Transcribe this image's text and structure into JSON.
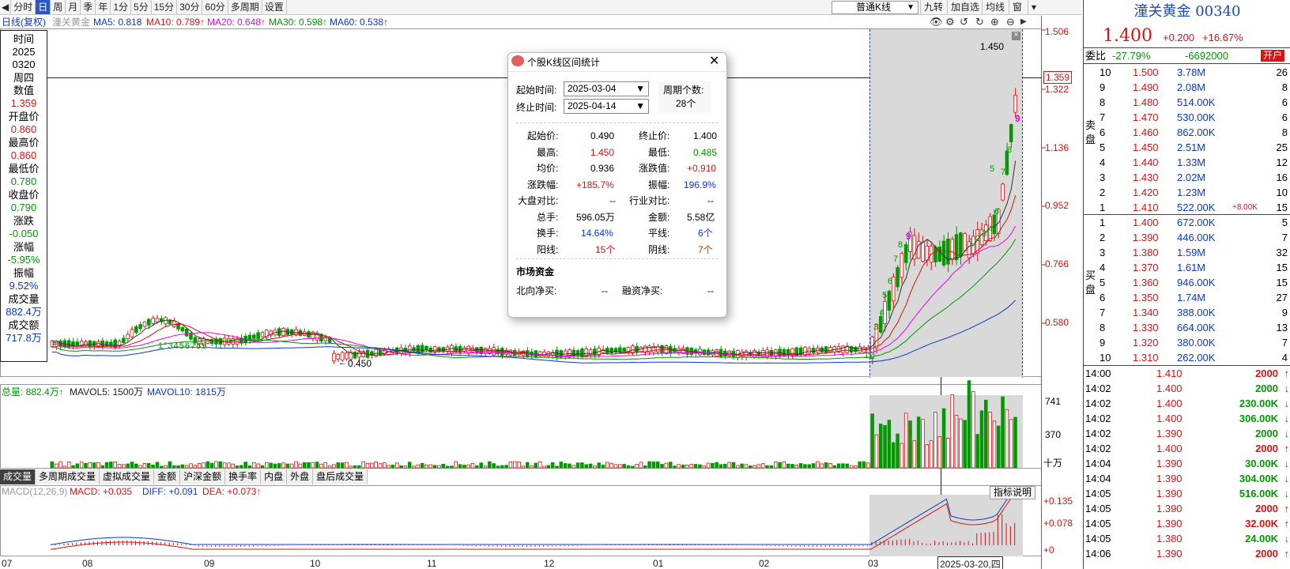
{
  "toolbar": {
    "periods": [
      "分时",
      "日",
      "周",
      "月",
      "季",
      "年",
      "1分",
      "5分",
      "15分",
      "30分",
      "60分",
      "多周期",
      "设置"
    ],
    "active_period": "日",
    "ktype": "普通K线",
    "nine": "九转",
    "add_watch": "加自选",
    "ma_line": "均线",
    "window": "窗"
  },
  "ma_info": {
    "label": "日线(复权)",
    "name": "潼关黄金",
    "ma5": "MA5: 0.818",
    "ma10": "MA10: 0.789↑",
    "ma20": "MA20: 0.648↑",
    "ma30": "MA30: 0.598↑",
    "ma60": "MA60: 0.538↑",
    "colors": {
      "ma5": "#0a38d0",
      "ma10": "#d11",
      "ma20": "#e0e",
      "ma30": "#090",
      "ma60": "#0a38d0"
    }
  },
  "left_panel": {
    "items": [
      {
        "label": "时间",
        "value": "2025",
        "value2": "0320"
      },
      {
        "label": "周四",
        "value": ""
      },
      {
        "label": "数值",
        "value": "1.359",
        "color": "red"
      },
      {
        "label": "开盘价",
        "value": "0.860",
        "color": "red"
      },
      {
        "label": "最高价",
        "value": "0.860",
        "color": "red"
      },
      {
        "label": "最低价",
        "value": "0.780",
        "color": "green"
      },
      {
        "label": "收盘价",
        "value": "0.790",
        "color": "green"
      },
      {
        "label": "涨跌",
        "value": "-0.050",
        "color": "green"
      },
      {
        "label": "涨幅",
        "value": "-5.95%",
        "color": "green"
      },
      {
        "label": "振幅",
        "value": "9.52%",
        "color": "blue"
      },
      {
        "label": "成交量",
        "value": "882.4万",
        "color": "blue"
      },
      {
        "label": "成交额",
        "value": "717.8万",
        "color": "blue"
      }
    ]
  },
  "price_axis": [
    "1.506",
    "1.359",
    "1.322",
    "1.136",
    "0.952",
    "0.766",
    "0.580"
  ],
  "chart_notes": {
    "high": "1.450",
    "low": "0.450"
  },
  "td_counts": {
    "a": "12",
    "b": "3",
    "c": "4",
    "d": "5",
    "e": "6",
    "f": "7",
    "g": "8",
    "h": "9",
    "i": "1",
    "j": "2",
    "k": "3",
    "l": "4",
    "m": "5",
    "n": "6",
    "o": "7",
    "p": "8",
    "q": "9",
    "early": "1°3456789"
  },
  "volume_info": {
    "total": "总量: 882.4万↑",
    "mavol5": "MAVOL5: 1500万",
    "mavol10": "MAVOL10: 1815万",
    "axis": [
      "741",
      "370",
      "十万"
    ]
  },
  "tabs": [
    "成交量",
    "多周期成交量",
    "虚拟成交量",
    "金额",
    "沪深金额",
    "换手率",
    "内盘",
    "外盘",
    "盘后成交量"
  ],
  "macd_info": {
    "label": "MACD(12,26,9)",
    "macd": "MACD: +0.035",
    "diff": "DIFF: +0.091",
    "dea": "DEA: +0.073↑",
    "axis": [
      "+0.135",
      "+0.078",
      "+0"
    ],
    "help": "指标说明"
  },
  "x_axis": [
    "07",
    "08",
    "09",
    "10",
    "11",
    "12",
    "01",
    "02",
    "03"
  ],
  "cursor_date": "2025-03-20,四",
  "dialog": {
    "title": "个股K线区间统计",
    "start_label": "起始时间:",
    "start": "2025-03-04",
    "end_label": "终止时间:",
    "end": "2025-04-14",
    "period_label": "周期个数:",
    "period_count": "28个",
    "rows": [
      [
        "起始价:",
        "0.490",
        "终止价:",
        "1.400"
      ],
      [
        "最高:",
        "1.450",
        "最低:",
        "0.485"
      ],
      [
        "均价:",
        "0.936",
        "涨跌值:",
        "+0.910"
      ],
      [
        "涨跌幅:",
        "+185.7%",
        "振幅:",
        "196.9%"
      ],
      [
        "大盘对比:",
        "--",
        "行业对比:",
        "--"
      ],
      [
        "总手:",
        "596.05万",
        "金额:",
        "5.58亿"
      ],
      [
        "换手:",
        "14.64%",
        "平线:",
        "6个"
      ],
      [
        "阳线:",
        "15个",
        "阴线:",
        "7个"
      ]
    ],
    "funds_title": "市场资金",
    "north_label": "北向净买:",
    "north": "--",
    "margin_label": "融资净买:",
    "margin": "--"
  },
  "quote": {
    "name": "潼关黄金 00340",
    "price": "1.400",
    "change": "+0.200",
    "pct": "+16.67%",
    "ratio_label": "委比",
    "ratio": "-27.79%",
    "diff": "-6692000",
    "open_btn": "开户",
    "sell_label": "卖盘",
    "buy_label": "买盘",
    "asks": [
      {
        "lvl": "10",
        "price": "1.500",
        "vol": "3.78M",
        "n": "26"
      },
      {
        "lvl": "9",
        "price": "1.490",
        "vol": "2.08M",
        "n": "8"
      },
      {
        "lvl": "8",
        "price": "1.480",
        "vol": "514.00K",
        "n": "6"
      },
      {
        "lvl": "7",
        "price": "1.470",
        "vol": "530.00K",
        "n": "6"
      },
      {
        "lvl": "6",
        "price": "1.460",
        "vol": "862.00K",
        "n": "8"
      },
      {
        "lvl": "5",
        "price": "1.450",
        "vol": "2.51M",
        "n": "25"
      },
      {
        "lvl": "4",
        "price": "1.440",
        "vol": "1.33M",
        "n": "12"
      },
      {
        "lvl": "3",
        "price": "1.430",
        "vol": "2.02M",
        "n": "16"
      },
      {
        "lvl": "2",
        "price": "1.420",
        "vol": "1.23M",
        "n": "10"
      },
      {
        "lvl": "1",
        "price": "1.410",
        "vol": "522.00K",
        "extra": "+8.00K",
        "n": "15"
      }
    ],
    "bids": [
      {
        "lvl": "1",
        "price": "1.400",
        "vol": "672.00K",
        "n": "5"
      },
      {
        "lvl": "2",
        "price": "1.390",
        "vol": "446.00K",
        "n": "7"
      },
      {
        "lvl": "3",
        "price": "1.380",
        "vol": "1.59M",
        "n": "32"
      },
      {
        "lvl": "4",
        "price": "1.370",
        "vol": "1.61M",
        "n": "15"
      },
      {
        "lvl": "5",
        "price": "1.360",
        "vol": "946.00K",
        "n": "15"
      },
      {
        "lvl": "6",
        "price": "1.350",
        "vol": "1.74M",
        "n": "27"
      },
      {
        "lvl": "7",
        "price": "1.340",
        "vol": "388.00K",
        "n": "9"
      },
      {
        "lvl": "8",
        "price": "1.330",
        "vol": "664.00K",
        "n": "13"
      },
      {
        "lvl": "9",
        "price": "1.320",
        "vol": "380.00K",
        "n": "7"
      },
      {
        "lvl": "10",
        "price": "1.310",
        "vol": "262.00K",
        "n": "4"
      }
    ],
    "trades": [
      {
        "t": "14:00",
        "p": "1.410",
        "v": "2000",
        "d": "up"
      },
      {
        "t": "14:02",
        "p": "1.400",
        "v": "2000",
        "d": "down"
      },
      {
        "t": "14:02",
        "p": "1.400",
        "v": "230.00K",
        "d": "down"
      },
      {
        "t": "14:02",
        "p": "1.400",
        "v": "306.00K",
        "d": "down"
      },
      {
        "t": "14:02",
        "p": "1.390",
        "v": "2000",
        "d": "down"
      },
      {
        "t": "14:02",
        "p": "1.400",
        "v": "2000",
        "d": "up"
      },
      {
        "t": "14:04",
        "p": "1.390",
        "v": "30.00K",
        "d": "down"
      },
      {
        "t": "14:04",
        "p": "1.390",
        "v": "304.00K",
        "d": "down"
      },
      {
        "t": "14:05",
        "p": "1.390",
        "v": "516.00K",
        "d": "down"
      },
      {
        "t": "14:05",
        "p": "1.390",
        "v": "2000",
        "d": "up"
      },
      {
        "t": "14:05",
        "p": "1.390",
        "v": "32.00K",
        "d": "up"
      },
      {
        "t": "14:05",
        "p": "1.380",
        "v": "24.00K",
        "d": "down"
      },
      {
        "t": "14:06",
        "p": "1.390",
        "v": "2000",
        "d": "up"
      }
    ]
  }
}
